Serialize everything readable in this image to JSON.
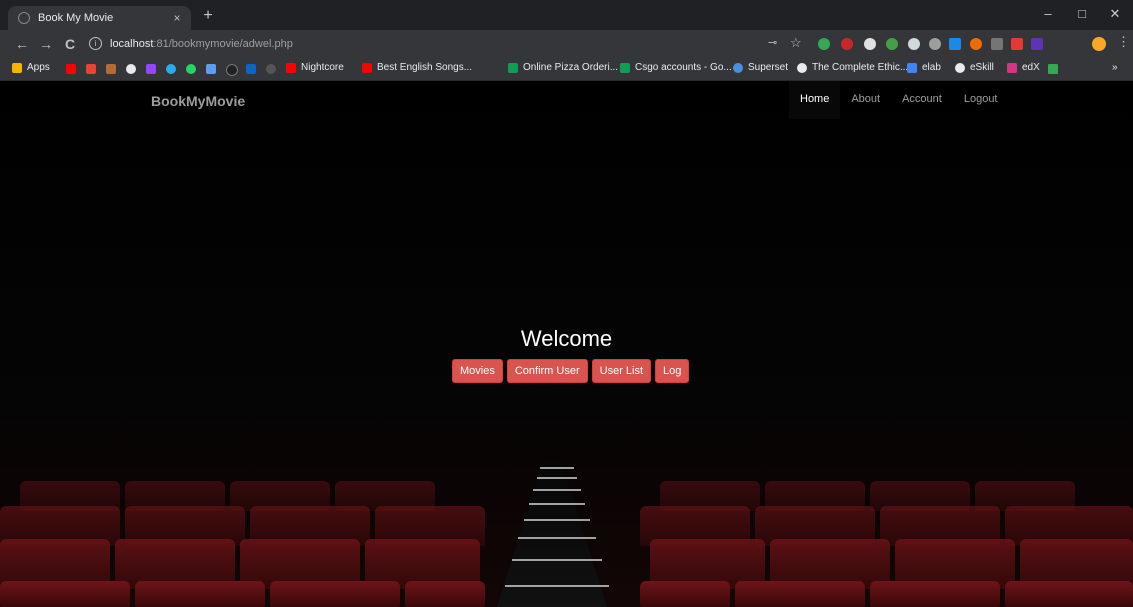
{
  "browser": {
    "tab_title": "Book My Movie",
    "tab_close": "×",
    "new_tab": "+",
    "window_controls": {
      "minimize": "–",
      "maximize": "□",
      "close": "✕"
    },
    "nav": {
      "back": "←",
      "forward": "→",
      "reload": "C"
    },
    "url_host": "localhost",
    "url_rest": ":81/bookmymovie/adwel.php",
    "bookmarks": [
      {
        "label": "Apps",
        "color": "#f4b400"
      },
      {
        "label": "Nightcore",
        "color": "#ff0000"
      },
      {
        "label": "Best English Songs...",
        "color": "#ff0000"
      },
      {
        "label": "Online Pizza Orderi...",
        "color": "#0f9d58"
      },
      {
        "label": "Csgo accounts - Go...",
        "color": "#0f9d58"
      },
      {
        "label": "Superset",
        "color": "#4a90e2"
      },
      {
        "label": "The Complete Ethic...",
        "color": "#ffffff"
      },
      {
        "label": "elab",
        "color": "#4285f4"
      },
      {
        "label": "eSkill",
        "color": "#ffffff"
      },
      {
        "label": "edX",
        "color": "#d33682"
      },
      {
        "label": "»",
        "color": ""
      }
    ]
  },
  "site": {
    "brand": "BookMyMovie",
    "nav": [
      {
        "label": "Home",
        "active": true
      },
      {
        "label": "About",
        "active": false
      },
      {
        "label": "Account",
        "active": false
      },
      {
        "label": "Logout",
        "active": false
      }
    ],
    "welcome": "Welcome",
    "buttons": [
      "Movies",
      "Confirm User",
      "User List",
      "Log"
    ],
    "button_color": "#d9534f"
  }
}
